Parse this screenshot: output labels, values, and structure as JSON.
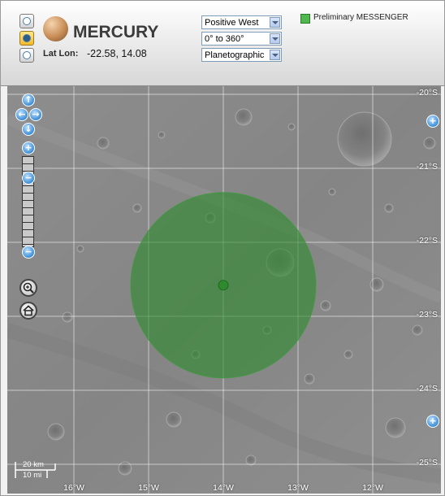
{
  "header": {
    "planet_name": "MERCURY",
    "latlon_label": "Lat Lon:",
    "latlon_value": "-22.58, 14.08",
    "view_buttons": [
      {
        "id": "north-pole-view",
        "active": false
      },
      {
        "id": "cylindrical-view",
        "active": true
      },
      {
        "id": "south-pole-view",
        "active": false
      }
    ],
    "selects": {
      "longitude_direction": "Positive West",
      "longitude_range": "0° to 360°",
      "latitude_type": "Planetographic"
    },
    "legend": {
      "label": "Preliminary MESSENGER",
      "color": "#4fb94f"
    }
  },
  "map": {
    "latitude_labels": [
      "-20°S",
      "-21°S",
      "-22°S",
      "-23°S",
      "-24°S",
      "-25°S"
    ],
    "longitude_labels": [
      "16°W",
      "15°W",
      "14°W",
      "13°W",
      "12°W"
    ],
    "grid_color": "#ffffff",
    "highlight": {
      "center_lat": -22.58,
      "center_lon_w": 14.0,
      "color": "#2e8b2e"
    },
    "scale": {
      "km_label": "20 km",
      "mi_label": "10 mi"
    },
    "controls": {
      "pan_icons": [
        "pan-up-icon",
        "pan-left-icon",
        "pan-right-icon",
        "pan-down-icon"
      ],
      "zoom_icons": [
        "zoom-in-icon",
        "zoom-out-icon"
      ],
      "tool_icons": [
        "magnify-tool-icon",
        "home-icon"
      ],
      "expand_icons": [
        "expand-top-icon",
        "expand-bottom-icon"
      ]
    }
  }
}
